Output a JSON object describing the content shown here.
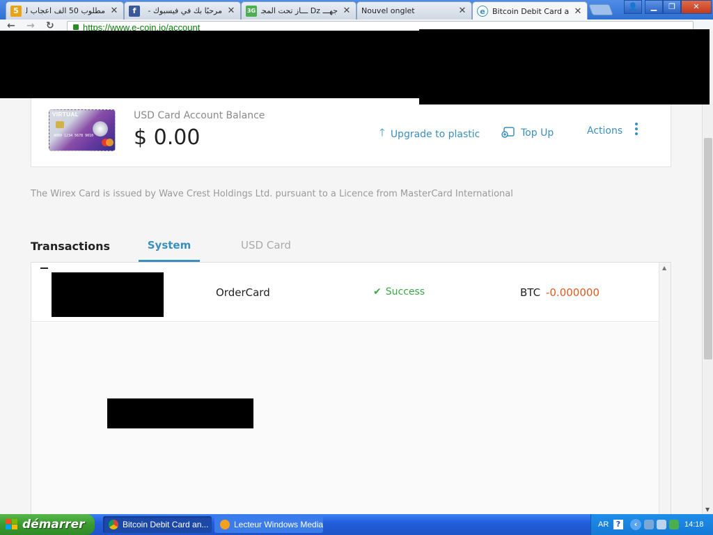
{
  "browser": {
    "tabs": [
      {
        "title": "مطلوب 50 الف اعجاب لـ",
        "favicon_text": "5",
        "favicon_color": "#e8a317"
      },
      {
        "title": "مرحبًا بك في فيسبوك -",
        "favicon_text": "f",
        "favicon_color": "#3b5998"
      },
      {
        "title": "جهـــ Dz ـــاز تحت المجـ",
        "favicon_text": "3G",
        "favicon_color": "#4caf50"
      },
      {
        "title": "Nouvel onglet",
        "favicon_text": "",
        "favicon_color": ""
      },
      {
        "title": "Bitcoin Debit Card and",
        "favicon_text": "e",
        "favicon_color": "#3a8fbf"
      }
    ],
    "close_glyph": "✕",
    "url": "https://www.e-coin.io/account"
  },
  "card": {
    "badge": "VIRTUAL",
    "number": "4000 1234 5678 9010",
    "balance_label": "USD Card Account Balance",
    "balance_value": "$ 0.00"
  },
  "actions": {
    "upgrade": "Upgrade to plastic",
    "topup": "Top Up",
    "actions": "Actions"
  },
  "disclaimer": "The Wirex Card is issued by Wave Crest Holdings Ltd. pursuant to a Licence from MasterCard International",
  "transactions": {
    "title": "Transactions",
    "tabs": [
      {
        "label": "System",
        "active": true
      },
      {
        "label": "USD Card",
        "active": false
      }
    ],
    "rows": [
      {
        "type": "OrderCard",
        "status": "Success",
        "currency": "BTC",
        "amount": "-0.000000"
      }
    ]
  },
  "taskbar": {
    "start_label": "démarrer",
    "tasks": [
      {
        "label": "Bitcoin Debit Card an...",
        "active": true
      },
      {
        "label": "Lecteur Windows Media",
        "active": false
      }
    ],
    "lang": "AR",
    "help": "?",
    "clock": "14:18"
  },
  "colors": {
    "accent": "#3a8fbf",
    "success": "#3aa845",
    "negative": "#e05a1e"
  }
}
